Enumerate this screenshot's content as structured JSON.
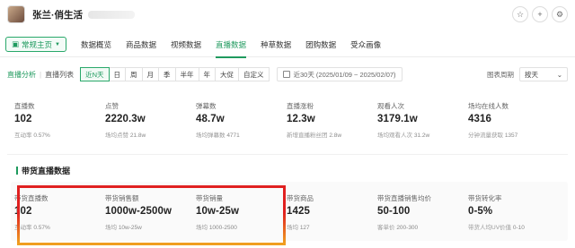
{
  "account": {
    "name": "张兰·俏生活"
  },
  "nav": {
    "home_label": "常规主页",
    "items": [
      "数据概览",
      "商品数据",
      "视频数据",
      "直播数据",
      "种草数据",
      "团购数据",
      "受众画像"
    ],
    "active": "直播数据"
  },
  "filter": {
    "tab_active": "直播分析",
    "tab_other": "直播列表",
    "ranges": [
      "近N天",
      "日",
      "周",
      "月",
      "季",
      "半年",
      "年",
      "大促",
      "自定义"
    ],
    "range_active": "近N天",
    "date_range": "近30天 (2025/01/09 ~ 2025/02/07)",
    "period_label": "图表周期",
    "period_value": "按天"
  },
  "overview": [
    {
      "label": "直播数",
      "value": "102",
      "sub_label": "互动率",
      "sub_value": "0.57%"
    },
    {
      "label": "点赞",
      "value": "2220.3w",
      "sub_label": "场均点赞",
      "sub_value": "21.8w"
    },
    {
      "label": "弹幕数",
      "value": "48.7w",
      "sub_label": "场均弹幕数",
      "sub_value": "4771"
    },
    {
      "label": "直播涨粉",
      "value": "12.3w",
      "sub_label": "新增直播粉丝团",
      "sub_value": "2.8w"
    },
    {
      "label": "观看人次",
      "value": "3179.1w",
      "sub_label": "场均观看人次",
      "sub_value": "31.2w"
    },
    {
      "label": "场均在线人数",
      "value": "4316",
      "sub_label": "分钟流量获取",
      "sub_value": "1357"
    }
  ],
  "section_title": "带货直播数据",
  "sales": [
    {
      "label": "带货直播数",
      "value": "102",
      "sub_label": "互动率",
      "sub_value": "0.57%"
    },
    {
      "label": "带货销售额",
      "value": "1000w-2500w",
      "sub_label": "场均",
      "sub_value": "10w-25w"
    },
    {
      "label": "带货销量",
      "value": "10w-25w",
      "sub_label": "场均",
      "sub_value": "1000-2500"
    },
    {
      "label": "带货商品",
      "value": "1425",
      "sub_label": "场均",
      "sub_value": "127"
    },
    {
      "label": "带货直播销售均价",
      "value": "50-100",
      "sub_label": "客单价",
      "sub_value": "200-300"
    },
    {
      "label": "带货转化率",
      "value": "0-5%",
      "sub_label": "带货人均UV价值",
      "sub_value": "0-10"
    }
  ],
  "colors": {
    "accent": "#1f9a5e",
    "highlight_top": "#e02020",
    "highlight_bottom": "#f0a020"
  }
}
